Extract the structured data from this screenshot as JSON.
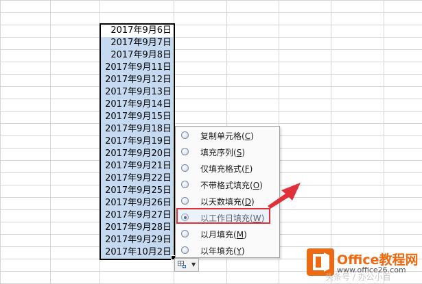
{
  "sheet": {
    "dates": [
      "2017年9月6日",
      "2017年9月7日",
      "2017年9月8日",
      "2017年9月11日",
      "2017年9月12日",
      "2017年9月13日",
      "2017年9月14日",
      "2017年9月15日",
      "2017年9月18日",
      "2017年9月19日",
      "2017年9月20日",
      "2017年9月21日",
      "2017年9月22日",
      "2017年9月25日",
      "2017年9月26日",
      "2017年9月27日",
      "2017年9月28日",
      "2017年9月29日",
      "2017年10月2日"
    ],
    "selection_color": "#c5daf1"
  },
  "autofill_menu": {
    "items": [
      {
        "text": "复制单元格",
        "key": "C"
      },
      {
        "text": "填充序列",
        "key": "S"
      },
      {
        "text": "仅填充格式",
        "key": "F"
      },
      {
        "text": "不带格式填充",
        "key": "O"
      },
      {
        "text": "以天数填充",
        "key": "D"
      },
      {
        "text": "以工作日填充",
        "key": "W"
      },
      {
        "text": "以月填充",
        "key": "M"
      },
      {
        "text": "以年填充",
        "key": "Y"
      }
    ],
    "selected_index": 5,
    "highlight_color": "#e0303a"
  },
  "autofill_button": {
    "icon": "auto-fill-options-icon"
  },
  "watermark": {
    "logo_title": "Office教程网",
    "logo_url": "www.office26.com",
    "caption": "头条号 / 办公小百"
  }
}
